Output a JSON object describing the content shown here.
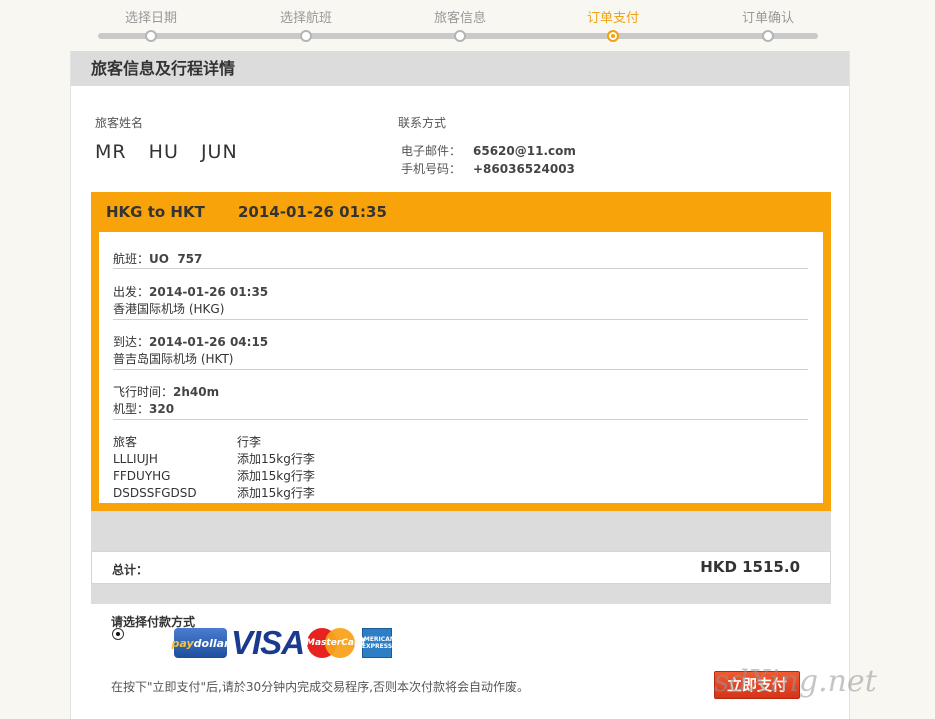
{
  "steps": [
    {
      "label": "选择日期",
      "state": "done"
    },
    {
      "label": "选择航班",
      "state": "done"
    },
    {
      "label": "旅客信息",
      "state": "done"
    },
    {
      "label": "订单支付",
      "state": "active"
    },
    {
      "label": "订单确认",
      "state": "pending"
    }
  ],
  "colors": {
    "accent": "#f9a30a",
    "step_active": "#f2a20f",
    "pay_button": "#e2411f"
  },
  "section_title": "旅客信息及行程详情",
  "passenger": {
    "label": "旅客姓名",
    "name": "MR  HU  JUN"
  },
  "contact": {
    "label": "联系方式",
    "email_label": "电子邮件：",
    "email": "65620@11.com",
    "phone_label": "手机号码：",
    "phone": "+86036524003"
  },
  "flight": {
    "route": "HKG to HKT",
    "datetime": "2014-01-26 01:35",
    "flight_no_label": "航班：",
    "flight_no": "UO  757",
    "depart_label": "出发：",
    "depart_time": "2014-01-26 01:35",
    "depart_airport": "香港国际机场 (HKG)",
    "arrive_label": "到达：",
    "arrive_time": "2014-01-26 04:15",
    "arrive_airport": "普吉岛国际机场 (HKT)",
    "duration_label": "飞行时间：",
    "duration": "2h40m",
    "aircraft_label": "机型：",
    "aircraft": "320",
    "passengers_header": "旅客",
    "baggage_header": "行李",
    "passengers": [
      {
        "name": "LLLIUJH",
        "baggage": "添加15kg行李"
      },
      {
        "name": "FFDUYHG",
        "baggage": "添加15kg行李"
      },
      {
        "name": "DSDSSFGDSD",
        "baggage": "添加15kg行李"
      }
    ]
  },
  "total": {
    "label": "总计：",
    "amount": "HKD 1515.0"
  },
  "payment": {
    "title": "请选择付款方式",
    "logos": {
      "paydollar_a": "pay",
      "paydollar_b": "dollar",
      "visa": "VISA",
      "mastercard": "MasterCard",
      "amex": "AMERICAN EXPRESS"
    },
    "note": "在按下\"立即支付\"后,请於30分钟内完成交易程序,否则本次付款将会自动作废。",
    "button": "立即支付"
  },
  "watermark": "sdXing.net"
}
